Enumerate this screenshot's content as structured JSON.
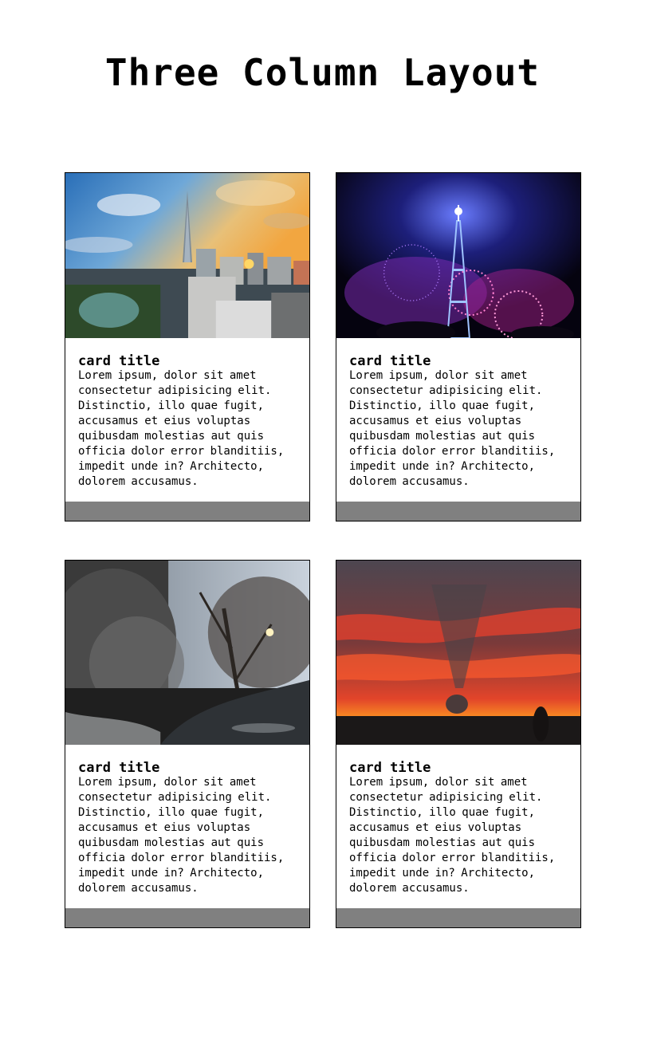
{
  "page": {
    "title": "Three Column Layout"
  },
  "cards": [
    {
      "image": "city-skyline-sunset-photo",
      "title": "card title",
      "text": "Lorem ipsum, dolor sit amet consectetur adipisicing elit. Distinctio, illo quae fugit, accusamus et eius voluptas quibusdam molestias aut quis officia dolor error blanditiis, impedit unde in? Architecto, dolorem accusamus."
    },
    {
      "image": "eiffel-tower-fireworks-photo",
      "title": "card title",
      "text": "Lorem ipsum, dolor sit amet consectetur adipisicing elit. Distinctio, illo quae fugit, accusamus et eius voluptas quibusdam molestias aut quis officia dolor error blanditiis, impedit unde in? Architecto, dolorem accusamus."
    },
    {
      "image": "winter-river-trees-photo",
      "title": "card title",
      "text": "Lorem ipsum, dolor sit amet consectetur adipisicing elit. Distinctio, illo quae fugit, accusamus et eius voluptas quibusdam molestias aut quis officia dolor error blanditiis, impedit unde in? Architecto, dolorem accusamus."
    },
    {
      "image": "red-sunset-sky-photo",
      "title": "card title",
      "text": "Lorem ipsum, dolor sit amet consectetur adipisicing elit. Distinctio, illo quae fugit, accusamus et eius voluptas quibusdam molestias aut quis officia dolor error blanditiis, impedit unde in? Architecto, dolorem accusamus."
    }
  ],
  "colors": {
    "footer": "#808080",
    "border": "#000000",
    "background": "#ffffff"
  }
}
